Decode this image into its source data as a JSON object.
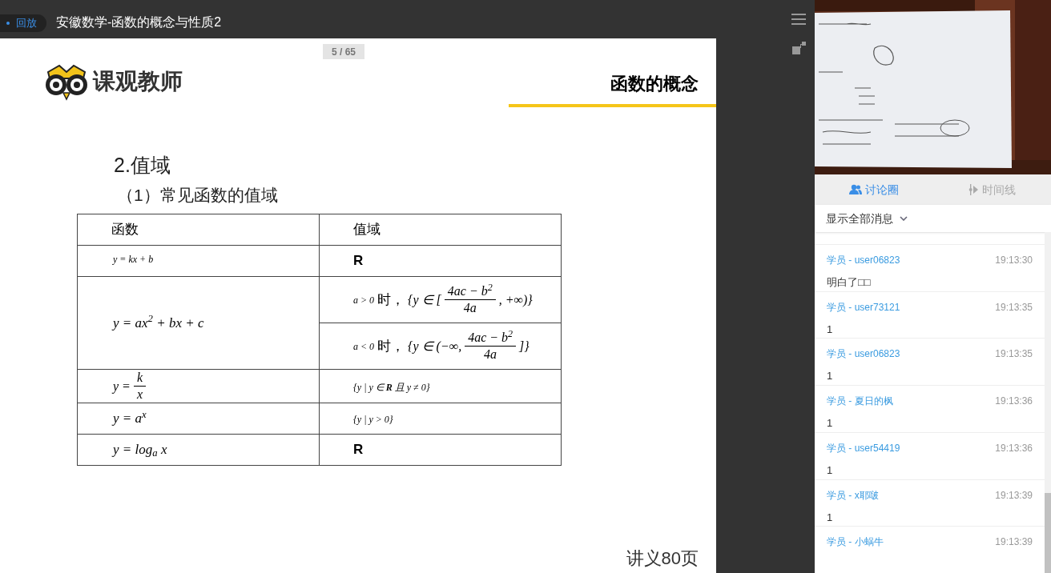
{
  "top_bar": {
    "badge": "回放",
    "title": "安徽数学-函数的概念与性质2"
  },
  "slide": {
    "page_counter": "5 / 65",
    "logo_text": "课观教师",
    "heading": "函数的概念",
    "section": "2.值域",
    "subsection": "（1）常见函数的值域",
    "table": {
      "columns": [
        "函数",
        "值域"
      ],
      "rows": [
        {
          "function": {
            "kind": "small_math",
            "text": "y = kx + b"
          },
          "ranges": [
            {
              "kind": "bold",
              "text": "R"
            }
          ]
        },
        {
          "function": {
            "kind": "math",
            "text": "y = ax$^{2}$ + bx + c"
          },
          "ranges": [
            {
              "kind": "fraction",
              "before": "a > 0",
              "label": "时，",
              "open": "{y ∈ [",
              "numerator": "4ac − b$^{2}$",
              "denominator": "4a",
              "after": ", +∞)}"
            },
            {
              "kind": "fraction",
              "before": "a < 0",
              "label": "时，",
              "open": "{y ∈ (−∞,",
              "numerator": "4ac − b$^{2}$",
              "denominator": "4a",
              "after": "]}"
            }
          ]
        },
        {
          "function": {
            "kind": "fraction",
            "open": "y =",
            "numerator": "k",
            "denominator": "x"
          },
          "ranges": [
            {
              "kind": "small_math",
              "text": "{y | y ∈ **R** 且 y ≠ 0}"
            }
          ]
        },
        {
          "function": {
            "kind": "math",
            "text": "y = a$^{x}$"
          },
          "ranges": [
            {
              "kind": "small_math",
              "text": "{y | y > 0}"
            }
          ]
        },
        {
          "function": {
            "kind": "math",
            "text": "y = log$_{a}$ x"
          },
          "ranges": [
            {
              "kind": "bold",
              "text": "R"
            }
          ]
        }
      ]
    },
    "footer": "讲义80页"
  },
  "side_panel": {
    "tabs": [
      {
        "label": "讨论圈",
        "selected": true
      },
      {
        "label": "时间线",
        "selected": false
      }
    ],
    "filter": "显示全部消息",
    "messages": [
      {
        "author": "学员 - user06823",
        "time": "19:13:30",
        "text": "明白了□□"
      },
      {
        "author": "学员 - user73121",
        "time": "19:13:35",
        "text": "1"
      },
      {
        "author": "学员 - user06823",
        "time": "19:13:35",
        "text": "1"
      },
      {
        "author": "学员 - 夏日的枫",
        "time": "19:13:36",
        "text": "1"
      },
      {
        "author": "学员 - user54419",
        "time": "19:13:36",
        "text": "1"
      },
      {
        "author": "学员 - x耶啵",
        "time": "19:13:39",
        "text": "1"
      },
      {
        "author": "学员 - 小蜗牛",
        "time": "19:13:39"
      }
    ]
  }
}
